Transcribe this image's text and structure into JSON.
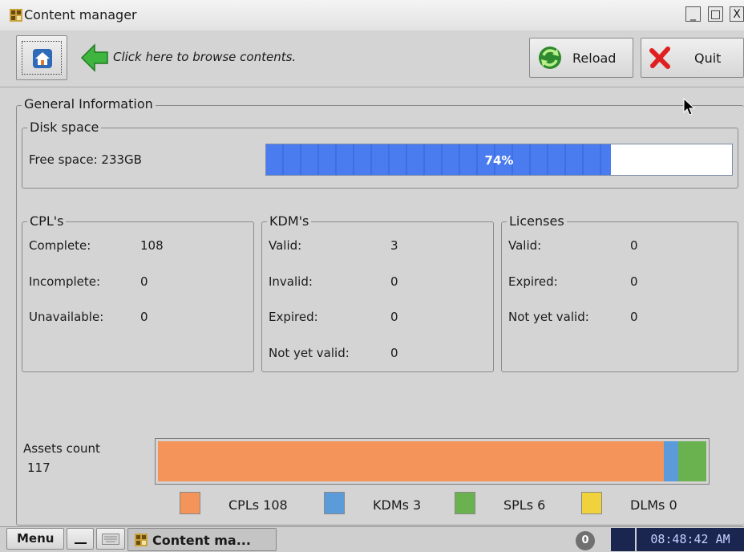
{
  "window": {
    "title": "Content manager",
    "minimize_glyph": "_",
    "maximize_glyph": "□",
    "close_glyph": "X"
  },
  "toolbar": {
    "browse_hint": "Click here to browse contents.",
    "reload_label": "Reload",
    "quit_label": "Quit"
  },
  "general": {
    "title": "General Information",
    "disk": {
      "title": "Disk space",
      "free_space_label": "Free space: 233GB",
      "usage_percent": 74,
      "usage_text": "74%"
    },
    "cpls": {
      "title": "CPL's",
      "rows": [
        {
          "label": "Complete:",
          "value": "108"
        },
        {
          "label": "Incomplete:",
          "value": "0"
        },
        {
          "label": "Unavailable:",
          "value": "0"
        }
      ]
    },
    "kdms": {
      "title": "KDM's",
      "rows": [
        {
          "label": "Valid:",
          "value": "3"
        },
        {
          "label": "Invalid:",
          "value": "0"
        },
        {
          "label": "Expired:",
          "value": "0"
        },
        {
          "label": "Not yet valid:",
          "value": "0"
        }
      ]
    },
    "licenses": {
      "title": "Licenses",
      "rows": [
        {
          "label": "Valid:",
          "value": "0"
        },
        {
          "label": "Expired:",
          "value": "0"
        },
        {
          "label": "Not yet valid:",
          "value": "0"
        }
      ]
    }
  },
  "assets": {
    "label_line1": "Assets count",
    "label_line2": "117",
    "total": 117,
    "segments": [
      {
        "name": "CPLs",
        "count": 108,
        "color": "#f4935a"
      },
      {
        "name": "KDMs",
        "count": 3,
        "color": "#5b9bd9"
      },
      {
        "name": "SPLs",
        "count": 6,
        "color": "#6ab150"
      },
      {
        "name": "DLMs",
        "count": 0,
        "color": "#f0d33c"
      }
    ],
    "legend": [
      {
        "text": "CPLs 108",
        "color": "#f4935a"
      },
      {
        "text": "KDMs 3",
        "color": "#5b9bd9"
      },
      {
        "text": "SPLs 6",
        "color": "#6ab150"
      },
      {
        "text": "DLMs 0",
        "color": "#f0d33c"
      }
    ]
  },
  "taskbar": {
    "menu_label": "Menu",
    "task_label": "Content ma...",
    "tray_badge": "0",
    "clock": "08:48:42 AM"
  }
}
